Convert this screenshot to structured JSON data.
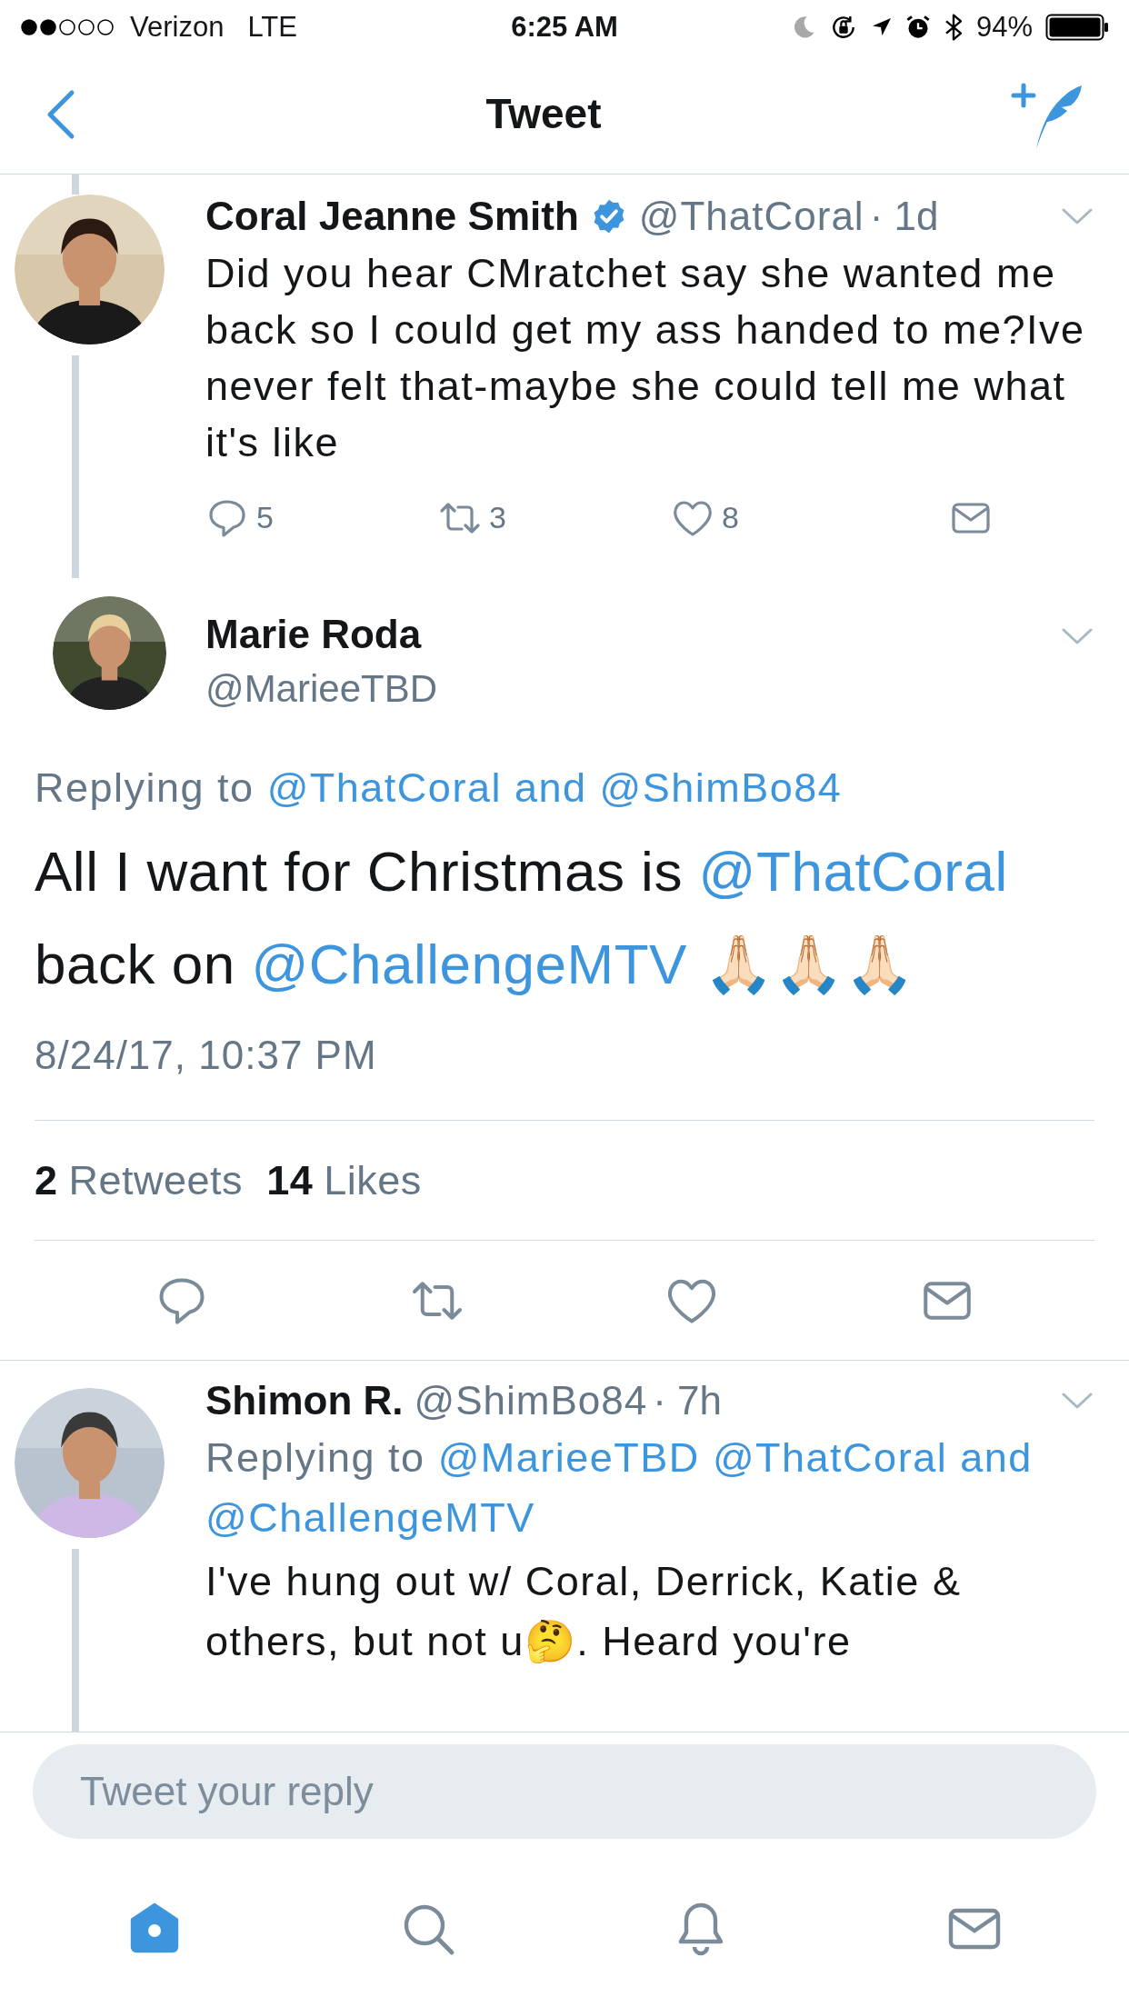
{
  "status_bar": {
    "carrier": "Verizon",
    "network": "LTE",
    "time": "6:25 AM",
    "battery": "94%"
  },
  "nav": {
    "title": "Tweet"
  },
  "parent_tweet": {
    "name": "Coral Jeanne Smith",
    "verified": true,
    "handle": "@ThatCoral",
    "time": "· 1d",
    "text": "Did you hear CMratchet say she wanted me back so I could get my ass handed to me?Ive never felt that-maybe she could tell me what it's like",
    "actions": [
      {
        "kind": "reply",
        "count": "5"
      },
      {
        "kind": "retweet",
        "count": "3"
      },
      {
        "kind": "like",
        "count": "8"
      },
      {
        "kind": "message"
      }
    ]
  },
  "main_tweet": {
    "name": "Marie Roda",
    "handle": "@MarieeTBD",
    "replying_prefix": "Replying to",
    "replying_links": [
      "@ThatCoral and @ShimBo84"
    ],
    "text": [
      {
        "kind": "plain",
        "text": "All I want for Christmas is "
      },
      {
        "kind": "mention",
        "text": "@ThatCoral"
      },
      {
        "kind": "plain",
        "text": " back on "
      },
      {
        "kind": "mention",
        "text": "@ChallengeMTV"
      },
      {
        "kind": "plain",
        "text": " 🙏🏻🙏🏻🙏🏻"
      }
    ],
    "date": "8/24/17, 10:37 PM",
    "stats": [
      {
        "count": "2",
        "label": "Retweets"
      },
      {
        "count": "14",
        "label": "Likes"
      }
    ],
    "actions": [
      {
        "kind": "reply"
      },
      {
        "kind": "retweet"
      },
      {
        "kind": "like"
      },
      {
        "kind": "message"
      }
    ]
  },
  "reply_tweet": {
    "name": "Shimon R.",
    "handle": "@ShimBo84",
    "time": "· 7h",
    "replying_prefix": "Replying to",
    "replying_links": [
      "@MarieeTBD",
      "@ThatCoral and",
      "@ChallengeMTV"
    ],
    "text": "I've hung out w/ Coral, Derrick, Katie & others, but not u🤔. Heard you're"
  },
  "reply_box": {
    "placeholder": "Tweet your reply"
  },
  "tab_bar": {
    "items": [
      {
        "kind": "home",
        "selected": true
      },
      {
        "kind": "search",
        "selected": false
      },
      {
        "kind": "notifications",
        "selected": false
      },
      {
        "kind": "messages",
        "selected": false
      }
    ]
  }
}
